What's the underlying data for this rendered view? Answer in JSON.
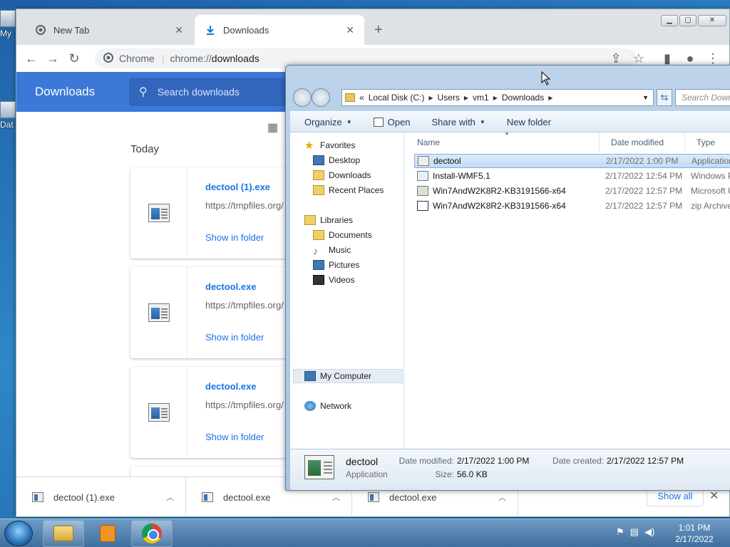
{
  "desktop": {
    "icon1_label": "My",
    "icon2_label": "Dat"
  },
  "chrome": {
    "tabs": [
      {
        "label": "New Tab",
        "active": false
      },
      {
        "label": "Downloads",
        "active": true
      }
    ],
    "site_label": "Chrome",
    "url_scheme": "chrome://",
    "url_host": "downloads",
    "downloads_title": "Downloads",
    "search_placeholder": "Search downloads",
    "today_label": "Today",
    "cards": [
      {
        "name": "dectool (1).exe",
        "url": "https://tmpfiles.org/",
        "action": "Show in folder"
      },
      {
        "name": "dectool.exe",
        "url": "https://tmpfiles.org/",
        "action": "Show in folder"
      },
      {
        "name": "dectool.exe",
        "url": "https://tmpfiles.org/",
        "action": "Show in folder"
      }
    ],
    "shelf": [
      {
        "name": "dectool (1).exe"
      },
      {
        "name": "dectool.exe"
      },
      {
        "name": "dectool.exe"
      }
    ],
    "show_all": "Show all"
  },
  "explorer": {
    "path": [
      "Local Disk (C:)",
      "Users",
      "vm1",
      "Downloads"
    ],
    "path_prefix": "«",
    "search_placeholder": "Search Down",
    "commands": {
      "organize": "Organize",
      "open": "Open",
      "share": "Share with",
      "new_folder": "New folder"
    },
    "nav": {
      "favorites": "Favorites",
      "desktop": "Desktop",
      "downloads": "Downloads",
      "recent": "Recent Places",
      "libraries": "Libraries",
      "documents": "Documents",
      "music": "Music",
      "pictures": "Pictures",
      "videos": "Videos",
      "computer": "My Computer",
      "network": "Network"
    },
    "columns": {
      "name": "Name",
      "date": "Date modified",
      "type": "Type"
    },
    "files": [
      {
        "name": "dectool",
        "date": "2/17/2022 1:00 PM",
        "type": "Application"
      },
      {
        "name": "Install-WMF5.1",
        "date": "2/17/2022 12:54 PM",
        "type": "Windows P"
      },
      {
        "name": "Win7AndW2K8R2-KB3191566-x64",
        "date": "2/17/2022 12:57 PM",
        "type": "Microsoft U"
      },
      {
        "name": "Win7AndW2K8R2-KB3191566-x64",
        "date": "2/17/2022 12:57 PM",
        "type": "zip Archive"
      }
    ],
    "details": {
      "name": "dectool",
      "type": "Application",
      "modified_label": "Date modified:",
      "modified_value": "2/17/2022 1:00 PM",
      "created_label": "Date created:",
      "created_value": "2/17/2022 12:57 PM",
      "size_label": "Size:",
      "size_value": "56.0 KB"
    }
  },
  "taskbar": {
    "time": "1:01 PM",
    "date": "2/17/2022"
  }
}
